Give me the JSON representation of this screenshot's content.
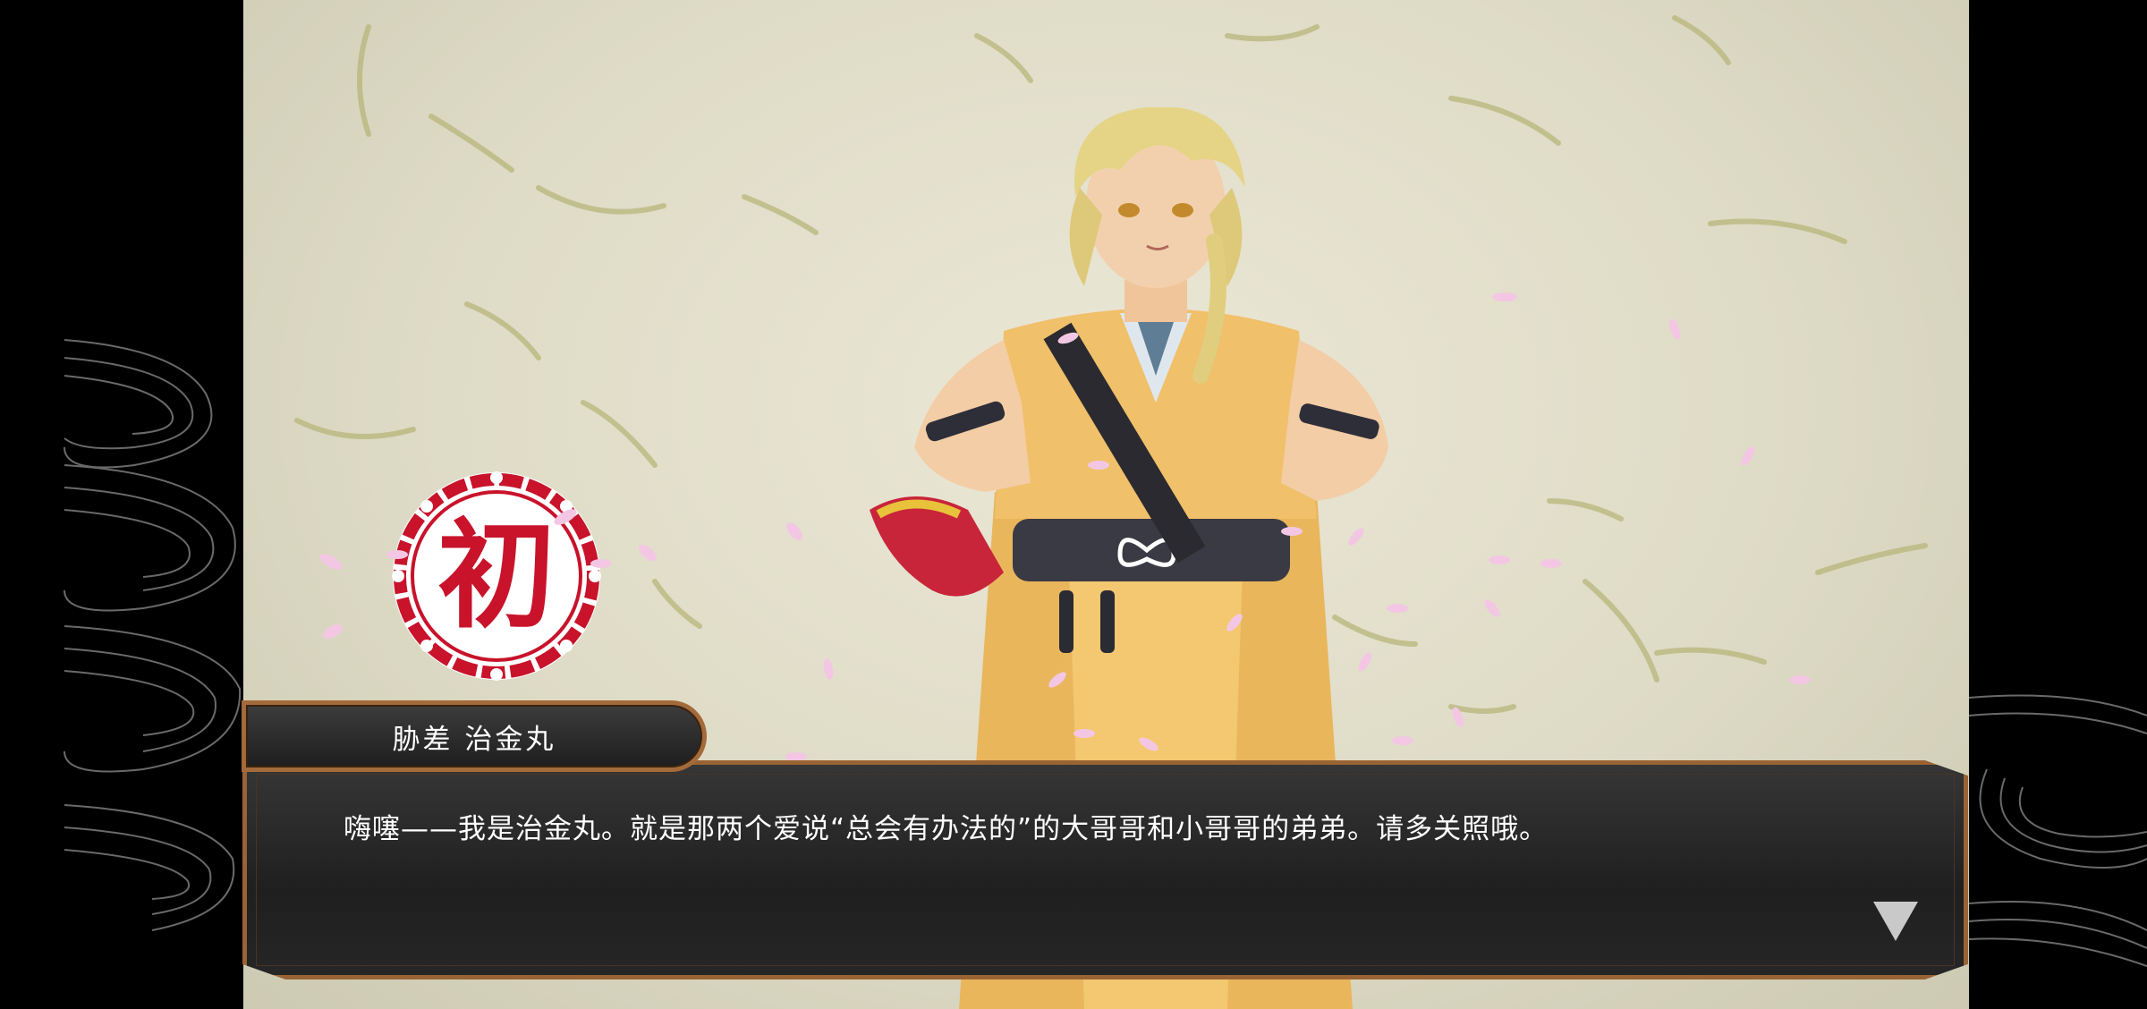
{
  "scene": {
    "seal_char": "初",
    "speaker_name": "胁差 治金丸",
    "dialog_text": "嗨噻——我是治金丸。就是那两个爱说“总会有办法的”的大哥哥和小哥哥的弟弟。请多关照哦。",
    "icons": [
      "wave-pattern",
      "hatsu-seal",
      "advance-arrow-icon"
    ],
    "colors": {
      "seal_red": "#c8132b",
      "dialog_bg": "#2a2a2a",
      "frame": "#9a6333",
      "paper": "#e4e0cc"
    }
  }
}
